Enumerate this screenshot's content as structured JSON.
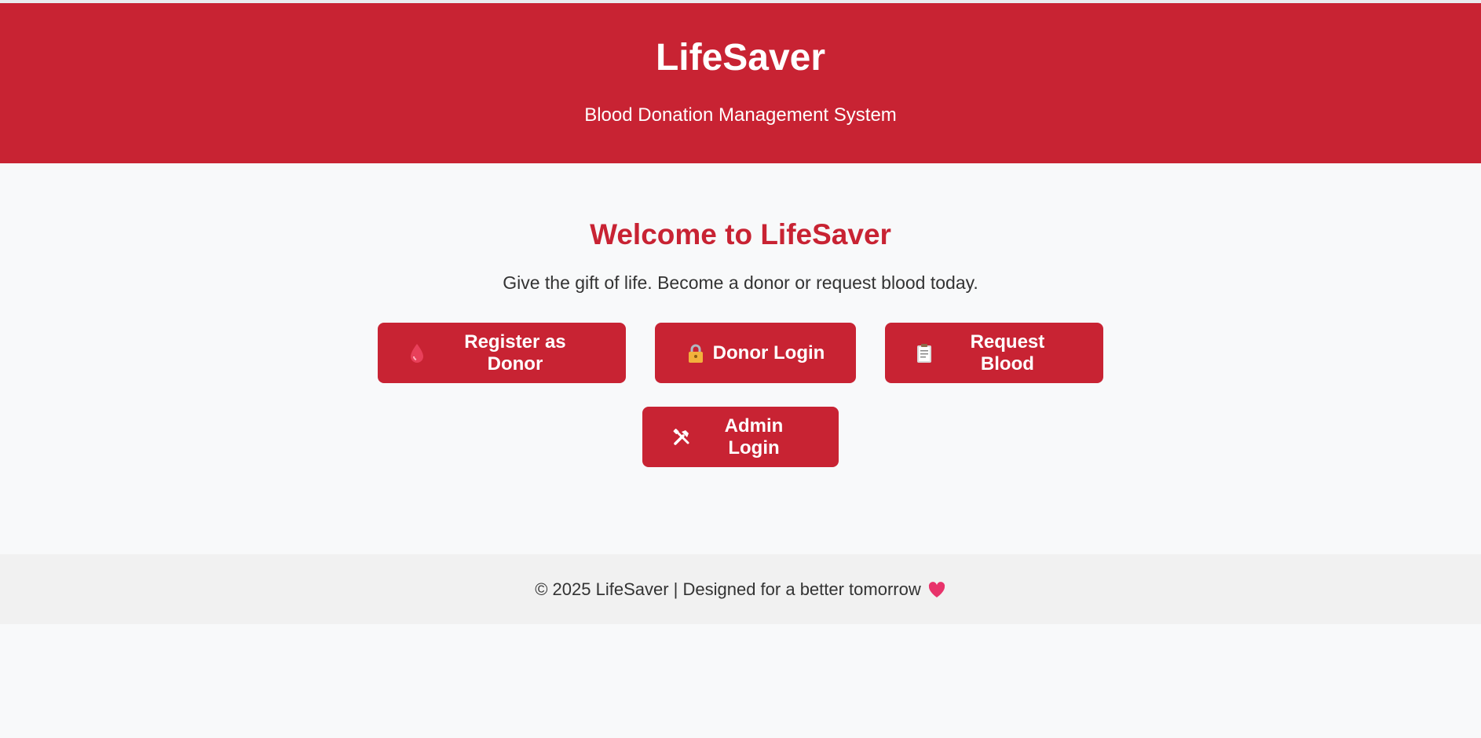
{
  "header": {
    "title": "LifeSaver",
    "subtitle": "Blood Donation Management System"
  },
  "main": {
    "heading": "Welcome to LifeSaver",
    "tagline": "Give the gift of life. Become a donor or request blood today.",
    "buttons": [
      {
        "label": "Register as Donor",
        "icon": "blood-drop-icon"
      },
      {
        "label": "Donor Login",
        "icon": "lock-icon"
      },
      {
        "label": "Request Blood",
        "icon": "clipboard-icon"
      },
      {
        "label": "Admin Login",
        "icon": "tools-icon"
      }
    ]
  },
  "footer": {
    "text": "© 2025 LifeSaver | Designed for a better tomorrow",
    "icon": "heart-icon"
  },
  "colors": {
    "brand": "#c82333",
    "background": "#f8f9fa",
    "footer_bg": "#f1f1f1",
    "text": "#333333"
  }
}
